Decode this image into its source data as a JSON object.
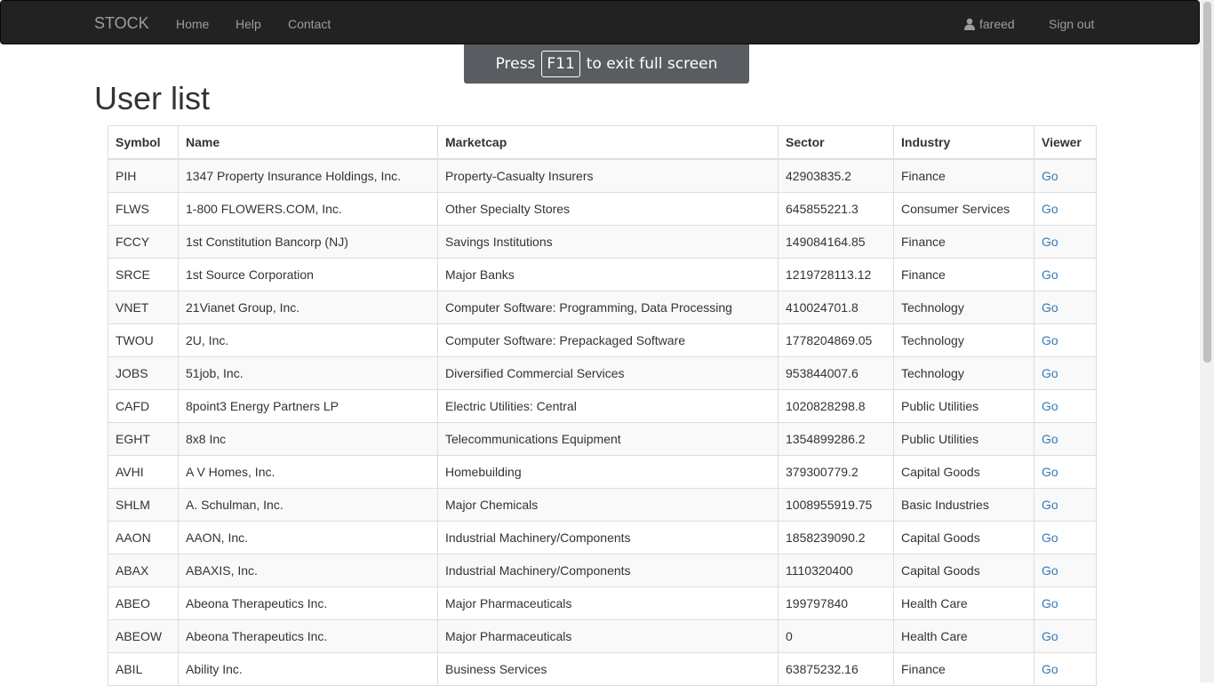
{
  "navbar": {
    "brand": "STOCK",
    "links": {
      "home": "Home",
      "help": "Help",
      "contact": "Contact"
    },
    "user": "fareed",
    "signout": "Sign out"
  },
  "fullscreen_banner": {
    "before": "Press",
    "key": "F11",
    "after": "to exit full screen"
  },
  "page": {
    "title": "User list"
  },
  "table": {
    "headers": [
      "Symbol",
      "Name",
      "Marketcap",
      "Sector",
      "Industry",
      "Viewer"
    ],
    "link_label": "Go",
    "rows": [
      [
        "PIH",
        "1347 Property Insurance Holdings, Inc.",
        "Property-Casualty Insurers",
        "42903835.2",
        "Finance"
      ],
      [
        "FLWS",
        "1-800 FLOWERS.COM, Inc.",
        "Other Specialty Stores",
        "645855221.3",
        "Consumer Services"
      ],
      [
        "FCCY",
        "1st Constitution Bancorp (NJ)",
        "Savings Institutions",
        "149084164.85",
        "Finance"
      ],
      [
        "SRCE",
        "1st Source Corporation",
        "Major Banks",
        "1219728113.12",
        "Finance"
      ],
      [
        "VNET",
        "21Vianet Group, Inc.",
        "Computer Software: Programming, Data Processing",
        "410024701.8",
        "Technology"
      ],
      [
        "TWOU",
        "2U, Inc.",
        "Computer Software: Prepackaged Software",
        "1778204869.05",
        "Technology"
      ],
      [
        "JOBS",
        "51job, Inc.",
        "Diversified Commercial Services",
        "953844007.6",
        "Technology"
      ],
      [
        "CAFD",
        "8point3 Energy Partners LP",
        "Electric Utilities: Central",
        "1020828298.8",
        "Public Utilities"
      ],
      [
        "EGHT",
        "8x8 Inc",
        "Telecommunications Equipment",
        "1354899286.2",
        "Public Utilities"
      ],
      [
        "AVHI",
        "A V Homes, Inc.",
        "Homebuilding",
        "379300779.2",
        "Capital Goods"
      ],
      [
        "SHLM",
        "A. Schulman, Inc.",
        "Major Chemicals",
        "1008955919.75",
        "Basic Industries"
      ],
      [
        "AAON",
        "AAON, Inc.",
        "Industrial Machinery/Components",
        "1858239090.2",
        "Capital Goods"
      ],
      [
        "ABAX",
        "ABAXIS, Inc.",
        "Industrial Machinery/Components",
        "1110320400",
        "Capital Goods"
      ],
      [
        "ABEO",
        "Abeona Therapeutics Inc.",
        "Major Pharmaceuticals",
        "199797840",
        "Health Care"
      ],
      [
        "ABEOW",
        "Abeona Therapeutics Inc.",
        "Major Pharmaceuticals",
        "0",
        "Health Care"
      ],
      [
        "ABIL",
        "Ability Inc.",
        "Business Services",
        "63875232.16",
        "Finance"
      ]
    ]
  }
}
